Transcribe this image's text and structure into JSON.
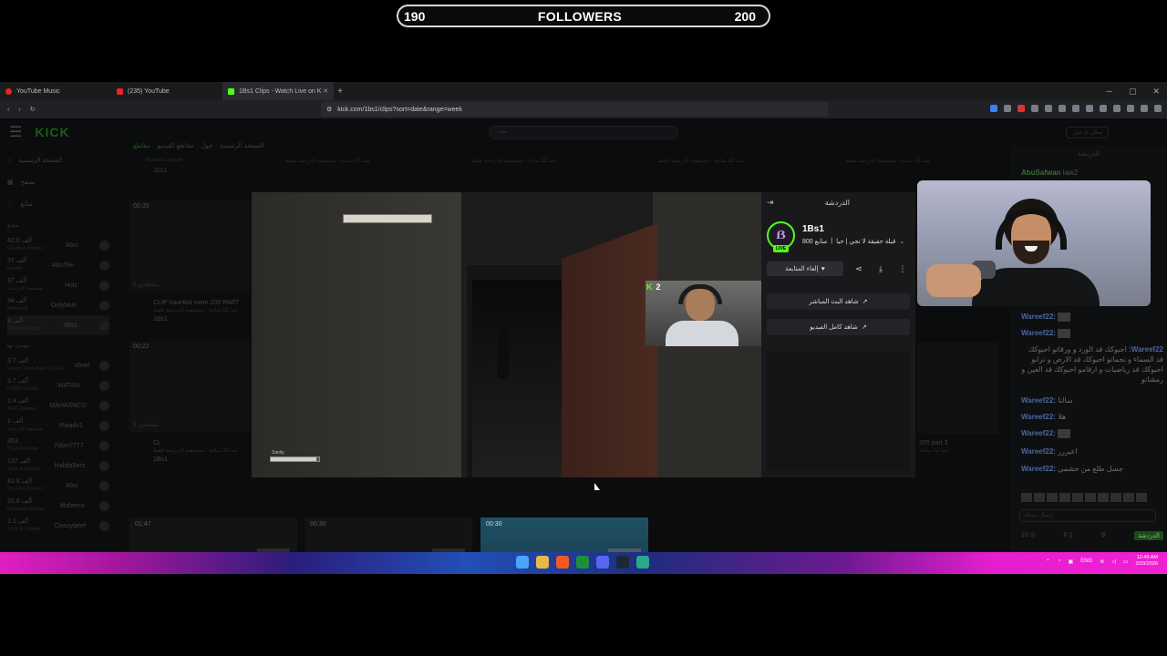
{
  "overlay": {
    "followers_current": "190",
    "followers_label": "FOLLOWERS",
    "followers_goal": "200",
    "followers_progress": 0.95
  },
  "browser": {
    "tabs": [
      {
        "label": "YouTube Music"
      },
      {
        "label": "(235) YouTube"
      },
      {
        "label": "1Bs1 Clips - Watch Live on K"
      }
    ],
    "url": "kick.com/1bs1/clips?sort=date&range=week"
  },
  "kick": {
    "search_placeholder": "بحث",
    "login": "سجّل الدخول",
    "sidebar": {
      "nav": [
        "الصفحة الرئيسية",
        "تصفح",
        "متابع"
      ],
      "section_following": "متابع",
      "following": [
        {
          "name": "Absi",
          "cat": "Counter-Strike 2",
          "count": "42.0 ألف"
        },
        {
          "name": "AboTee",
          "cat": "Hearth",
          "count": "37 ألف"
        },
        {
          "name": "Holz",
          "cat": "مجتمعية الدردشة",
          "count": "37 ألف"
        },
        {
          "name": "OnlyMuh",
          "cat": "Minecraft",
          "count": "34 ألف"
        },
        {
          "name": "1Bs1",
          "cat": "Rocket League",
          "count": "3 ألف"
        }
      ],
      "section_recommended": "موصى بها",
      "recommended": [
        {
          "name": "xbxel",
          "cat": "Grand Theft Auto V (GTA)",
          "count": "3.7 ألف"
        },
        {
          "name": "WATAN",
          "cat": "PUBG Mobile",
          "count": "3.7 ألف"
        },
        {
          "name": "MAHASNCO",
          "cat": "ARC Raiders",
          "count": "2.4 ألف"
        },
        {
          "name": "Raiadv1",
          "cat": "مجتمعية الدردشة",
          "count": "1 ألف"
        },
        {
          "name": "7idan7777",
          "cat": "Chat Roulette",
          "count": "853"
        },
        {
          "name": "HabibiBetz",
          "cat": "Slots & Casino",
          "count": "137 ألف"
        },
        {
          "name": "Absi",
          "cat": "Counter-Strike 2",
          "count": "42.8 ألف"
        },
        {
          "name": "Maherco",
          "cat": "Dinosaur Games",
          "count": "25.8 ألف"
        },
        {
          "name": "Classybeef",
          "cat": "Slots & Casino",
          "count": "2.1 ألف"
        }
      ]
    },
    "crumbs": [
      "مقاطع",
      "مقاطع الفيديو",
      "حول",
      "الصفحة الرئيسية"
    ],
    "top_row": [
      "Rocket League",
      "منذ 22 ساعة - مجتمعية الدردشة فقط",
      "منذ 22 ساعة - مجتمعية الدردشة فقط",
      "منذ 22 ساعة - مجتمعية الدردشة فقط",
      "منذ 22 ساعة - مجتمعية الدردشة فقط",
      "1bs1"
    ],
    "cards": [
      {
        "dur": "00:35",
        "views": "مشاهدين 2",
        "title": "CLIP haunted room 205 PART",
        "sub": "منذ 22 ساعة - مجتمعية الدردشة فقط",
        "author": "1Bs1"
      },
      {
        "dur": "00:22",
        "views": "مشاهدين 3",
        "title": "CL",
        "sub": "منذ 22 ساعة - مجتمعية الدردشة فقط",
        "author": "1Bs1"
      }
    ],
    "right_card": {
      "title": "205 part 3",
      "sub": "منذ 22 ساعة"
    },
    "bottom_clips": [
      {
        "dur": "01:47"
      },
      {
        "dur": "00:30"
      },
      {
        "dur": "00:30"
      }
    ],
    "chat": {
      "header": "الدردشة",
      "user_top": "AbuSafwan",
      "user_top2": "law2",
      "messages": [
        {
          "user": "Wareef22:",
          "text": ""
        },
        {
          "user": "Wareef22:",
          "text": ""
        },
        {
          "user": "Wareef22:",
          "text": "احبوكك قد الورد و ورقاتو احبوكك قد السماء و نجماتو احبوكك قد الارض و ترابو احبوكك قد رياضيات و ارقامو احبوكك قد العين و رمشاتو"
        },
        {
          "user": "Wareef22:",
          "text": "سالتا"
        },
        {
          "user": "Wareef22:",
          "text": "هلا"
        },
        {
          "user": "Wareef22:",
          "text": ""
        },
        {
          "user": "Wareef22:",
          "text": "اعيررر"
        },
        {
          "user": "Wareef22:",
          "text": "جسل طلع من حشمي"
        }
      ],
      "input_placeholder": "إرسال رسالة",
      "points": "10",
      "count": "0",
      "send": "الدردشة"
    }
  },
  "modal": {
    "panel_title": "الدردشة",
    "streamer": "1Bs1",
    "followers_info": "800 متابع",
    "stream_title": "قيلة حقيقة لا تجي | حيا",
    "follow_btn": "إلغاء المتابعة",
    "watch_live": "شاهد البث المباشر",
    "watch_full": "شاهد كامل الفيديو",
    "live_badge": "LIVE",
    "viewers": "2",
    "hud_label": "Sanity",
    "hud_level": 0.95
  },
  "taskbar": {
    "lang": "ENG",
    "time": "12:49 AM",
    "date": "3/29/2026"
  }
}
